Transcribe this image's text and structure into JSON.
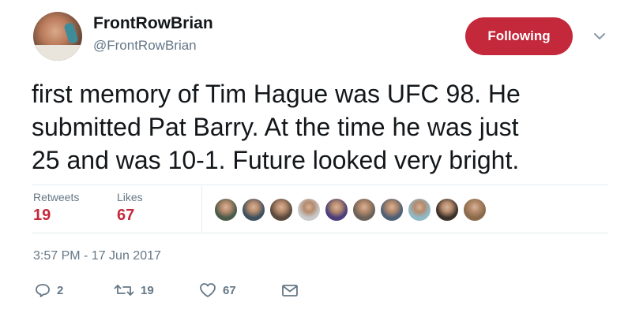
{
  "author": {
    "display_name": "FrontRowBrian",
    "handle": "@FrontRowBrian",
    "avatar_icon": "user-avatar"
  },
  "follow_button": {
    "label": "Following",
    "color": "#c4283b"
  },
  "menu_icon": "chevron-down-icon",
  "tweet": {
    "lines": [
      "first memory of Tim Hague was UFC 98. He",
      "submitted Pat Barry. At the time he was just",
      "25 and was 10-1. Future looked very bright."
    ]
  },
  "stats": {
    "retweets_label": "Retweets",
    "retweets_value": "19",
    "likes_label": "Likes",
    "likes_value": "67"
  },
  "likers": [
    {
      "name": "liker-avatar-1",
      "color": "#4a5a48"
    },
    {
      "name": "liker-avatar-2",
      "color": "#3e4f5e"
    },
    {
      "name": "liker-avatar-3",
      "color": "#5a4a3e"
    },
    {
      "name": "liker-avatar-4",
      "color": "#c9c9c9"
    },
    {
      "name": "liker-avatar-5",
      "color": "#4a3d7a"
    },
    {
      "name": "liker-avatar-6",
      "color": "#6b6158"
    },
    {
      "name": "liker-avatar-7",
      "color": "#4f5f74"
    },
    {
      "name": "liker-avatar-8",
      "color": "#8fb9c7"
    },
    {
      "name": "liker-avatar-9",
      "color": "#3a3028"
    },
    {
      "name": "liker-avatar-10",
      "color": "#8a6a4a"
    }
  ],
  "timestamp": "3:57 PM - 17 Jun 2017",
  "actions": {
    "reply_icon": "reply-icon",
    "reply_count": "2",
    "retweet_icon": "retweet-icon",
    "retweet_count": "19",
    "like_icon": "heart-icon",
    "like_count": "67",
    "dm_icon": "envelope-icon"
  },
  "colors": {
    "accent": "#c4283b",
    "muted": "#657786",
    "text": "#14171a",
    "divider": "#e6ecf0"
  }
}
